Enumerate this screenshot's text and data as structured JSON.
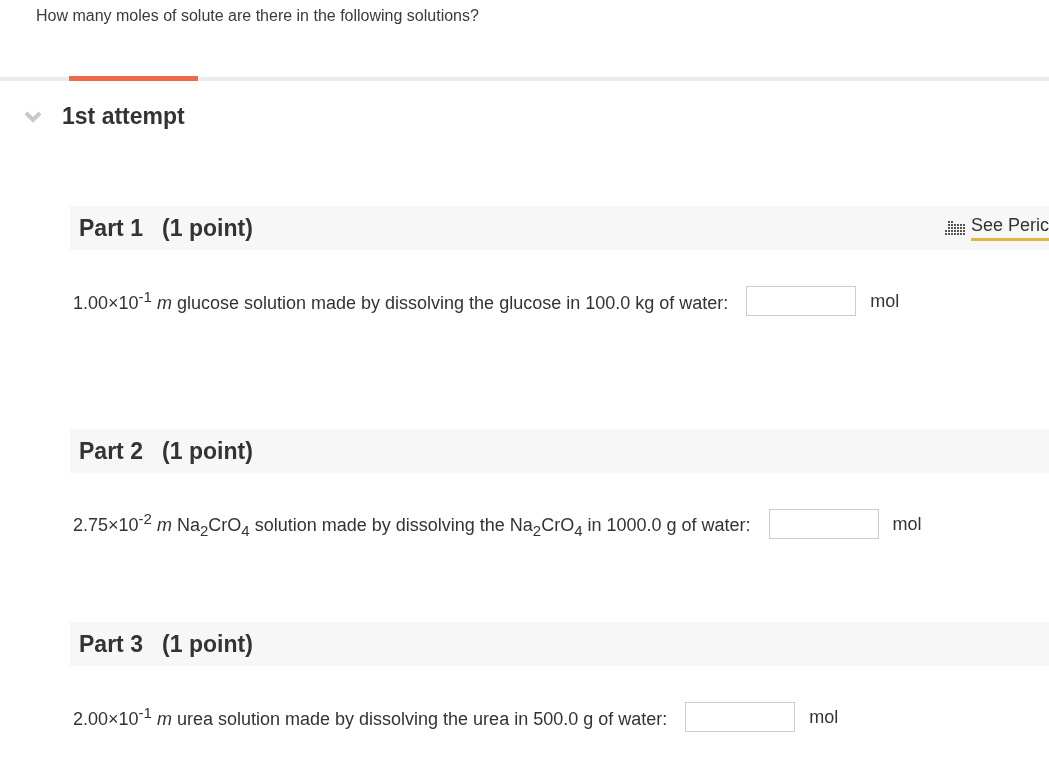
{
  "question": "How many moles of solute are there in the following solutions?",
  "attempt": {
    "label": "1st attempt",
    "expanded": true
  },
  "parts": [
    {
      "title": "Part 1",
      "points": "(1 point)",
      "prompt": "1.00×10$^{-1}$  *m* glucose solution made by dissolving the glucose in 100.0 kg of water:",
      "unit": "mol",
      "periodic_link": "See Peric"
    },
    {
      "title": "Part 2",
      "points": "(1 point)",
      "prompt": "2.75×10$^{-2}$  *m* Na$_{2}$CrO$_{4}$ solution made by dissolving the Na$_{2}$CrO$_{4}$ in 1000.0 g of water:",
      "unit": "mol"
    },
    {
      "title": "Part 3",
      "points": "(1 point)",
      "prompt": "2.00×10$^{-1}$  *m* urea solution made by dissolving the urea in 500.0 g of water:",
      "unit": "mol"
    }
  ]
}
